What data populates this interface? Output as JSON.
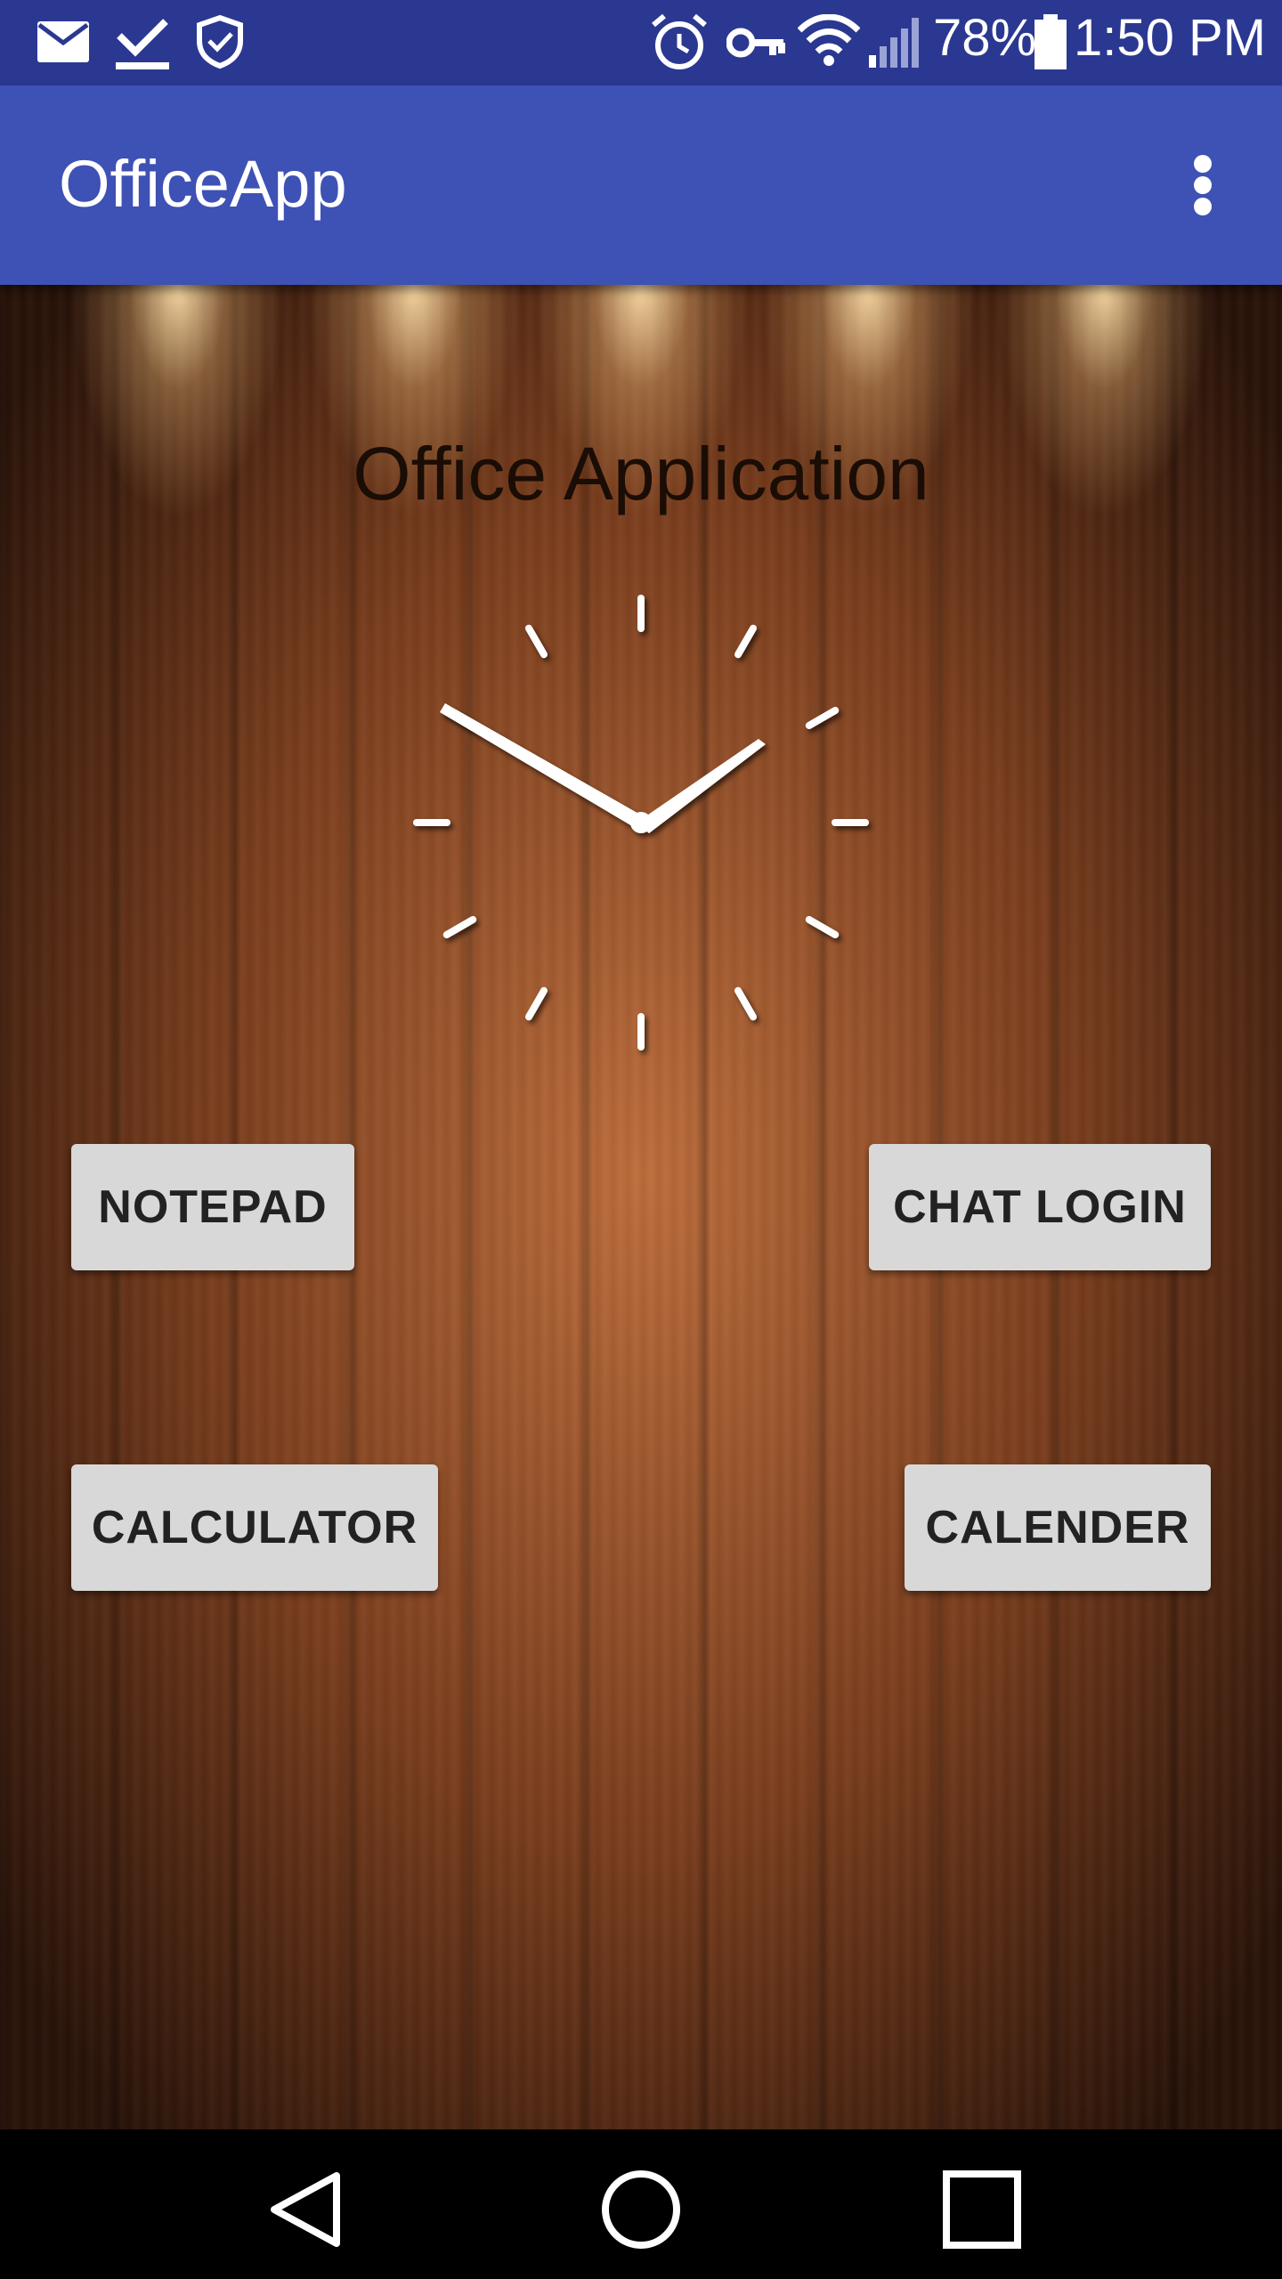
{
  "status_bar": {
    "icons": [
      "mail-icon",
      "download-done-icon",
      "shield-icon",
      "alarm-icon",
      "vpn-key-icon",
      "wifi-icon",
      "signal-icon",
      "battery-icon"
    ],
    "battery": "78%",
    "time": "1:50 PM"
  },
  "app_bar": {
    "title": "OfficeApp",
    "menu_icon": "more-vert-icon"
  },
  "main": {
    "heading": "Office Application",
    "clock_icon": "analog-clock",
    "buttons": {
      "notepad": "NOTEPAD",
      "chat_login": "CHAT LOGIN",
      "calculator": "CALCULATOR",
      "calender": "CALENDER"
    }
  },
  "nav_bar": {
    "icons": [
      "back-icon",
      "home-icon",
      "recents-icon"
    ]
  },
  "colors": {
    "status_bar": "#2b3891",
    "app_bar": "#3e51b5",
    "button_bg": "#d8d8d8",
    "button_text": "#222222"
  }
}
